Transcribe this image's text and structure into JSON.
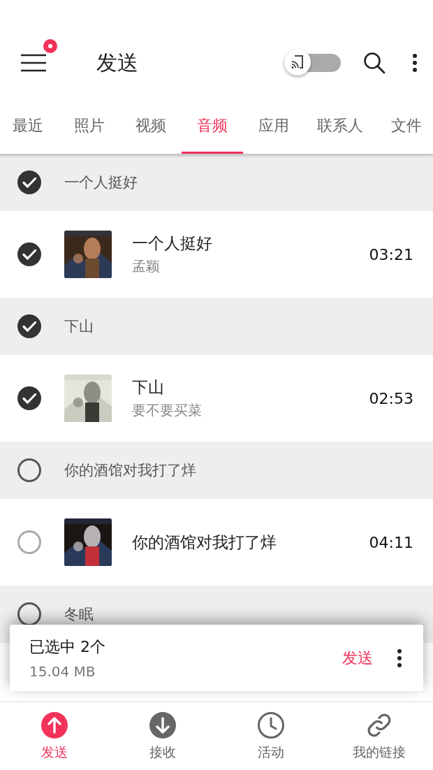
{
  "header": {
    "title": "发送",
    "menu_badge": true,
    "toggle": {
      "on": false
    }
  },
  "tabs": [
    {
      "label": "最近",
      "selected": false
    },
    {
      "label": "照片",
      "selected": false
    },
    {
      "label": "视频",
      "selected": false
    },
    {
      "label": "音频",
      "selected": true
    },
    {
      "label": "应用",
      "selected": false
    },
    {
      "label": "联系人",
      "selected": false
    },
    {
      "label": "文件",
      "selected": false
    }
  ],
  "sections": [
    {
      "title": "一个人挺好",
      "checked": true,
      "songs": [
        {
          "title": "一个人挺好",
          "artist": "孟颖",
          "duration": "03:21",
          "checked": true
        }
      ]
    },
    {
      "title": "下山",
      "checked": true,
      "songs": [
        {
          "title": "下山",
          "artist": "要不要买菜",
          "duration": "02:53",
          "checked": true
        }
      ]
    },
    {
      "title": "你的酒馆对我打了烊",
      "checked": false,
      "songs": [
        {
          "title": "你的酒馆对我打了烊",
          "duration": "04:11",
          "checked": false
        }
      ]
    },
    {
      "title": "冬眠",
      "checked": false
    }
  ],
  "selection": {
    "summary": "已选中 2个",
    "size": "15.04 MB",
    "action": "发送"
  },
  "nav": [
    {
      "label": "发送",
      "kind": "send",
      "selected": true
    },
    {
      "label": "接收",
      "kind": "receive",
      "selected": false
    },
    {
      "label": "活动",
      "kind": "activity",
      "selected": false
    },
    {
      "label": "我的链接",
      "kind": "link",
      "selected": false
    }
  ]
}
